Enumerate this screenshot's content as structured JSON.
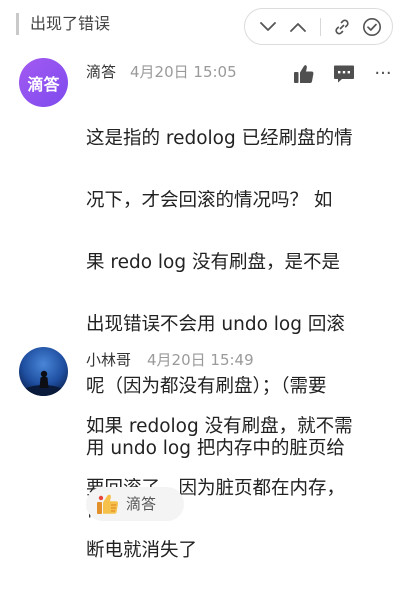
{
  "header": {
    "quote": "出现了错误"
  },
  "toolbar": {
    "icons": [
      "chevron-down-icon",
      "chevron-up-icon",
      "link-icon",
      "check-circle-icon"
    ]
  },
  "comments": [
    {
      "avatar_text": "滴答",
      "name": "滴答",
      "date": "4月20日 15:05",
      "lines": [
        "这是指的 redolog 已经刷盘的情",
        "况下，才会回滚的情况吗？ 如",
        "果 redo log 没有刷盘，是不是",
        "出现错误不会用 undo log 回滚",
        "呢（因为都没有刷盘）；（需要",
        "用 undo log 把内存中的脏页给",
        "恢复吗)"
      ],
      "actions": [
        "thumbs-up-icon",
        "comment-icon",
        "more-icon"
      ],
      "more_label": "···"
    },
    {
      "name": "小林哥",
      "date": "4月20日 15:49",
      "lines": [
        "如果 redolog 没有刷盘，就不需",
        "要回滚了，因为脏页都在内存，",
        "断电就消失了"
      ],
      "reaction": {
        "emoji": "thumbs-up-emoji",
        "user": "滴答"
      }
    }
  ],
  "colors": {
    "avatar_gradient": [
      "#a35af0",
      "#7e4bef"
    ],
    "meta_gray": "#9a9a9a",
    "action_gray": "#4f4f4f"
  }
}
